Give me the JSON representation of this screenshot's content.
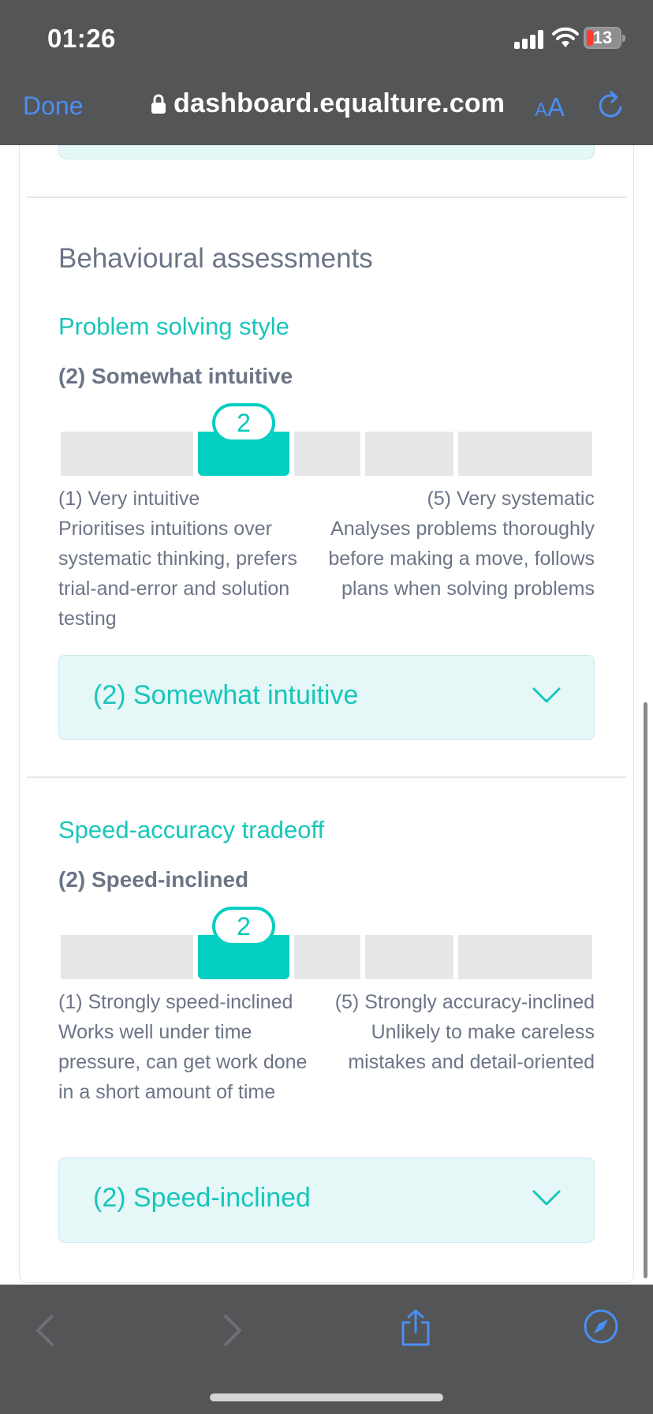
{
  "status_bar": {
    "time": "01:26",
    "battery": "13",
    "icons": [
      "signal-icon",
      "wifi-icon",
      "battery-icon"
    ]
  },
  "browser": {
    "done_label": "Done",
    "url": "dashboard.equalture.com",
    "aa_small": "A",
    "aa_big": "A",
    "icons": [
      "lock-icon",
      "reload-icon",
      "back-icon",
      "forward-icon",
      "share-icon",
      "compass-icon"
    ]
  },
  "colors": {
    "accent": "#05cfc0",
    "accent_text": "#17c6ba",
    "link_blue": "#4a8ff5",
    "muted_text": "#6c7586",
    "chrome": "#545557",
    "select_bg": "#e5f7f7"
  },
  "page": {
    "section_title": "Behavioural assessments",
    "assessments": [
      {
        "title": "Problem solving style",
        "level_label": "(2) Somewhat intuitive",
        "scale_value": 2,
        "scale_max": 5,
        "knob_label": "2",
        "left_pole": {
          "title": "(1) Very intuitive",
          "description": "Prioritises intuitions over systematic thinking, prefers trial-and-error and solution testing"
        },
        "right_pole": {
          "title": "(5) Very systematic",
          "description": "Analyses problems thoroughly before making a move, follows plans when solving problems"
        },
        "selected_value": "(2) Somewhat intuitive"
      },
      {
        "title": "Speed-accuracy tradeoff",
        "level_label": "(2) Speed-inclined",
        "scale_value": 2,
        "scale_max": 5,
        "knob_label": "2",
        "left_pole": {
          "title": "(1) Strongly speed-inclined",
          "description": "Works well under time pressure, can get work done in a short amount of time"
        },
        "right_pole": {
          "title": "(5) Strongly accuracy-inclined",
          "description": "Unlikely to make careless mistakes and detail-oriented"
        },
        "selected_value": "(2) Speed-inclined"
      }
    ]
  }
}
